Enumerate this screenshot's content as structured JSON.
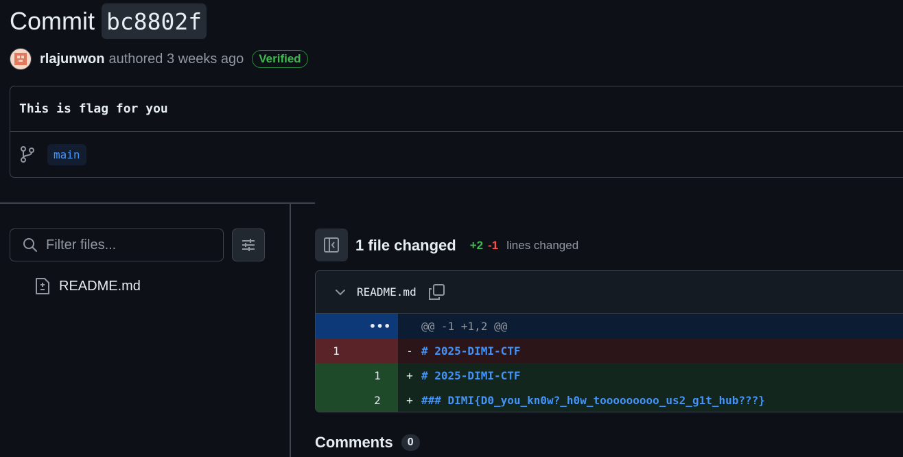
{
  "commit": {
    "title_word": "Commit",
    "sha": "bc8802f",
    "author": "rlajunwon",
    "authored_text": "authored 3 weeks ago",
    "verified_label": "Verified",
    "message": "This is flag for you",
    "branch": "main"
  },
  "sidebar": {
    "filter_placeholder": "Filter files...",
    "files": [
      {
        "name": "README.md",
        "status": "modified"
      }
    ]
  },
  "summary": {
    "files_changed": "1 file changed",
    "additions": "+2",
    "deletions": "-1",
    "lines_label": "lines changed"
  },
  "diff": {
    "filename": "README.md",
    "hunk_header": "@@ -1 +1,2 @@",
    "expand_label": "•••",
    "lines": [
      {
        "type": "del",
        "old": "1",
        "new": "",
        "sign": "-",
        "text": "# 2025-DIMI-CTF"
      },
      {
        "type": "add",
        "old": "",
        "new": "1",
        "sign": "+",
        "text": "# 2025-DIMI-CTF"
      },
      {
        "type": "add",
        "old": "",
        "new": "2",
        "sign": "+",
        "text": "### DIMI{D0_you_kn0w?_h0w_tooooooooo_us2_g1t_hub???}"
      }
    ]
  },
  "comments": {
    "label": "Comments",
    "count": "0"
  },
  "colors": {
    "background": "#0d1117",
    "addition": "#3fb950",
    "deletion": "#f85149",
    "link": "#4493f8"
  }
}
